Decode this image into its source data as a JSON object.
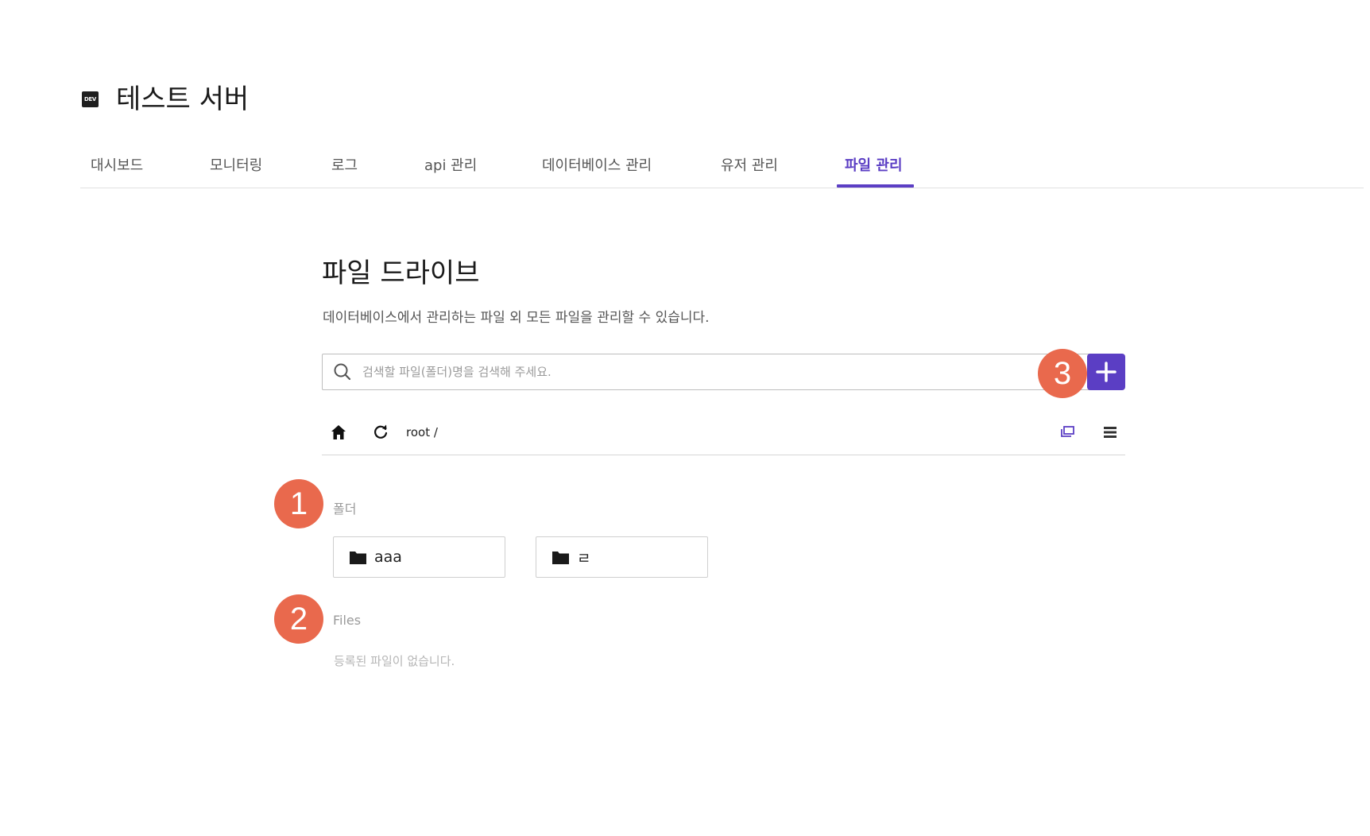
{
  "server": {
    "badge": "DEV",
    "title": "테스트 서버"
  },
  "tabs": [
    {
      "label": "대시보드",
      "active": false
    },
    {
      "label": "모니터링",
      "active": false
    },
    {
      "label": "로그",
      "active": false
    },
    {
      "label": "api 관리",
      "active": false
    },
    {
      "label": "데이터베이스 관리",
      "active": false
    },
    {
      "label": "유저 관리",
      "active": false
    },
    {
      "label": "파일 관리",
      "active": true
    }
  ],
  "drive": {
    "title": "파일 드라이브",
    "description": "데이터베이스에서 관리하는 파일 외 모든 파일을 관리할 수 있습니다.",
    "search_placeholder": "검색할 파일(폴더)명을 검색해 주세요.",
    "path": "root /"
  },
  "folders_section": {
    "label": "폴더",
    "items": [
      {
        "name": "aaa"
      },
      {
        "name": "ㄹ"
      }
    ]
  },
  "files_section": {
    "label": "Files",
    "empty_text": "등록된 파일이 없습니다."
  },
  "markers": [
    "1",
    "2",
    "3"
  ],
  "colors": {
    "accent": "#5b3ec4",
    "marker": "#e9694d"
  }
}
